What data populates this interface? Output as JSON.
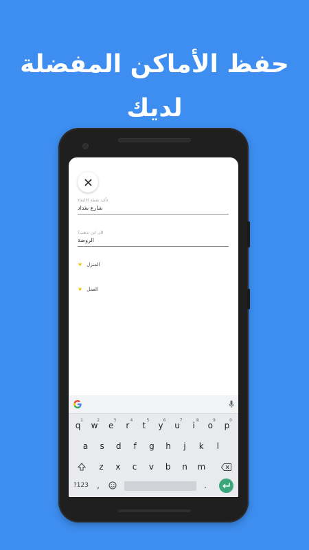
{
  "headline": "حفظ الأماكن المفضلة لديك",
  "form": {
    "pickup": {
      "label": "تأكيد نقطة الالتقاء",
      "value": "شارع بغداد"
    },
    "destination": {
      "label": "الى اين تذهب؟",
      "value": "الروضة"
    }
  },
  "favorites": [
    {
      "name": "المنزل",
      "icon": "star-icon"
    },
    {
      "name": "العمل",
      "icon": "star-icon"
    }
  ],
  "keyboard": {
    "row1": [
      {
        "key": "q",
        "sup": "1"
      },
      {
        "key": "w",
        "sup": "2"
      },
      {
        "key": "e",
        "sup": "3"
      },
      {
        "key": "r",
        "sup": "4"
      },
      {
        "key": "t",
        "sup": "5"
      },
      {
        "key": "y",
        "sup": "6"
      },
      {
        "key": "u",
        "sup": "7"
      },
      {
        "key": "i",
        "sup": "8"
      },
      {
        "key": "o",
        "sup": "9"
      },
      {
        "key": "p",
        "sup": "0"
      }
    ],
    "row2": [
      "a",
      "s",
      "d",
      "f",
      "g",
      "h",
      "j",
      "k",
      "l"
    ],
    "row3": [
      "z",
      "x",
      "c",
      "v",
      "b",
      "n",
      "m"
    ],
    "symbols_label": "?123",
    "comma_label": ",",
    "period_label": "."
  },
  "colors": {
    "background": "#3d8ef0",
    "star": "#f2c200",
    "enter_key": "#3ba77b"
  }
}
